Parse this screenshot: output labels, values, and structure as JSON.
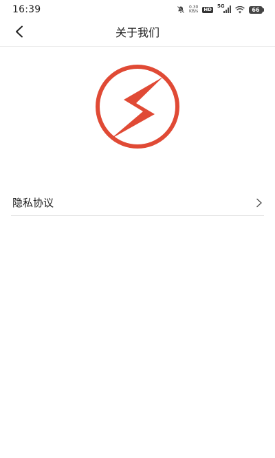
{
  "status_bar": {
    "time": "16:39",
    "net_speed_value": "0.30",
    "net_speed_unit": "KB/s",
    "hd_label": "HD",
    "signal_label": "5G",
    "battery_level": "66"
  },
  "header": {
    "title": "关于我们",
    "back_icon": "chevron-left-icon"
  },
  "logo": {
    "icon": "lightning-bolt-logo",
    "color": "#e04a35"
  },
  "menu": {
    "items": [
      {
        "label": "隐私协议",
        "icon": "chevron-right-icon"
      }
    ]
  }
}
